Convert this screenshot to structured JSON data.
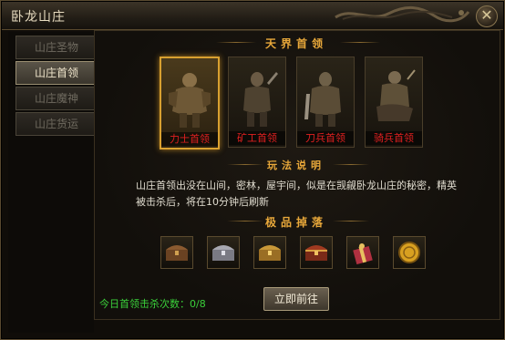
{
  "window": {
    "title": "卧龙山庄",
    "close_symbol": "✕"
  },
  "sidebar": {
    "items": [
      {
        "label": "山庄圣物",
        "active": false
      },
      {
        "label": "山庄首领",
        "active": true
      },
      {
        "label": "山庄魔神",
        "active": false
      },
      {
        "label": "山庄货运",
        "active": false
      }
    ]
  },
  "sections": {
    "bosses_title": "天界首领",
    "rules_title": "玩法说明",
    "drops_title": "极品掉落"
  },
  "bosses": [
    {
      "label": "力士首领",
      "selected": true,
      "icon": "warrior-boss-icon"
    },
    {
      "label": "矿工首领",
      "selected": false,
      "icon": "miner-boss-icon"
    },
    {
      "label": "刀兵首领",
      "selected": false,
      "icon": "blade-boss-icon"
    },
    {
      "label": "骑兵首领",
      "selected": false,
      "icon": "cavalry-boss-icon"
    }
  ],
  "description": "山庄首领出没在山间，密林，屋宇间，似是在觊觎卧龙山庄的秘密，精英被击杀后，将在10分钟后刷新",
  "drops": [
    {
      "icon": "bronze-chest-icon"
    },
    {
      "icon": "silver-chest-icon"
    },
    {
      "icon": "gold-chest-icon"
    },
    {
      "icon": "red-chest-icon"
    },
    {
      "icon": "gift-box-icon"
    },
    {
      "icon": "gold-coin-icon"
    }
  ],
  "footer": {
    "kill_count_text": "今日首领击杀次数：0/8",
    "go_button": "立即前往"
  },
  "colors": {
    "accent_gold": "#e8a83a",
    "boss_label_red": "#e02020",
    "kill_count_green": "#3ad03a",
    "active_border": "#d8a030"
  }
}
